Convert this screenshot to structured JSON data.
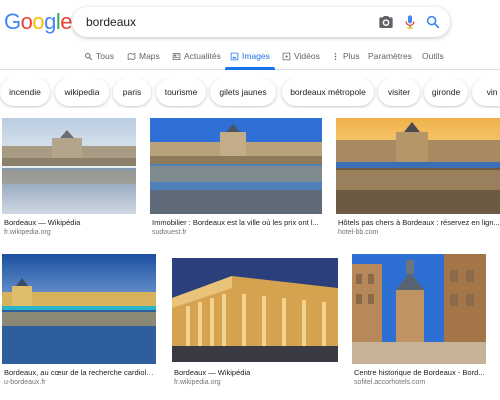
{
  "logo": {
    "letters": [
      "G",
      "o",
      "o",
      "g",
      "l",
      "e"
    ],
    "colors": [
      "#4285F4",
      "#EA4335",
      "#FBBC05",
      "#4285F4",
      "#34A853",
      "#EA4335"
    ]
  },
  "search": {
    "query": "bordeaux",
    "camera_icon": "camera-icon",
    "mic_icon": "mic-icon",
    "search_icon": "search-icon"
  },
  "tabs": [
    {
      "label": "Tous",
      "icon": "search-icon",
      "active": false
    },
    {
      "label": "Maps",
      "icon": "map-icon",
      "active": false
    },
    {
      "label": "Actualités",
      "icon": "news-icon",
      "active": false
    },
    {
      "label": "Images",
      "icon": "image-icon",
      "active": true
    },
    {
      "label": "Vidéos",
      "icon": "video-icon",
      "active": false
    },
    {
      "label": "Plus",
      "icon": "more-vertical-icon",
      "active": false
    },
    {
      "label": "Paramètres",
      "icon": "",
      "active": false
    },
    {
      "label": "Outils",
      "icon": "",
      "active": false
    }
  ],
  "chips": [
    "incendie",
    "wikipedia",
    "paris",
    "tourisme",
    "gilets jaunes",
    "bordeaux métropole",
    "visiter",
    "gironde",
    "vin"
  ],
  "results": [
    {
      "title": "Bordeaux — Wikipédia",
      "source": "fr.wikipedia.org"
    },
    {
      "title": "Immobilier : Bordeaux est la ville où les prix ont l...",
      "source": "sudouest.fr"
    },
    {
      "title": "Hôtels pas chers à Bordeaux : réservez en lign...",
      "source": "hotel-bb.com"
    },
    {
      "title": "Bordeaux, au cœur de la recherche cardiolo...",
      "source": "u-bordeaux.fr"
    },
    {
      "title": "Bordeaux — Wikipédia",
      "source": "fr.wikipedia.org"
    },
    {
      "title": "Centre historique de Bordeaux - Bord...",
      "source": "sofitel.accorhotels.com"
    }
  ],
  "colors": {
    "accent": "#1a73e8",
    "tab_text": "#5f6368",
    "source_text": "#70757a"
  }
}
